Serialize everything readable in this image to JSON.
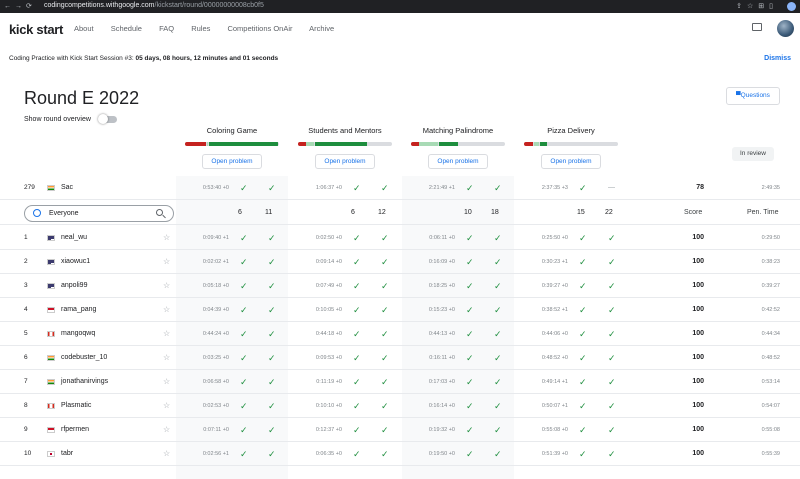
{
  "browser": {
    "host": "codingcompetitions.withgoogle.com",
    "path": "/kickstart/round/00000000008cb0f5"
  },
  "header": {
    "logo": "kick start",
    "nav": [
      "About",
      "Schedule",
      "FAQ",
      "Rules",
      "Competitions OnAir",
      "Archive"
    ]
  },
  "banner": {
    "text": "Coding Practice with Kick Start Session #3:",
    "countdown": "05 days, 08 hours, 12 minutes and 01 seconds",
    "dismiss": "Dismiss"
  },
  "round": {
    "title": "Round E 2022",
    "questions_label": "Questions",
    "overview_label": "Show round overview",
    "review_label": "In review",
    "open_label": "Open problem"
  },
  "problems": [
    {
      "name": "Coloring Game",
      "red": 0.22,
      "light": 0.02,
      "green": 0.73
    },
    {
      "name": "Students and Mentors",
      "red": 0.08,
      "light": 0.08,
      "green": 0.55
    },
    {
      "name": "Matching Palindrome",
      "red": 0.08,
      "light": 0.2,
      "green": 0.2
    },
    {
      "name": "Pizza Delivery",
      "red": 0.1,
      "light": 0.05,
      "green": 0.07
    }
  ],
  "my_row": {
    "rank": "279",
    "flag": "IN",
    "name": "Sac",
    "times": [
      "0:53:40 +0",
      "1:06:37 +0",
      "2:21:49 +1",
      "2:37:35 +3"
    ],
    "p4_second": "—",
    "score": "78",
    "penalty": "2:49:35"
  },
  "header_row": {
    "search": "Everyone",
    "counts": [
      [
        "6",
        "11"
      ],
      [
        "6",
        "12"
      ],
      [
        "10",
        "18"
      ],
      [
        "15",
        "22"
      ]
    ],
    "score_label": "Score",
    "penalty_label": "Pen. Time"
  },
  "rows": [
    {
      "rank": "1",
      "flag": "US",
      "name": "neal_wu",
      "times": [
        "0:09:40 +1",
        "0:02:50 +0",
        "0:06:11 +0",
        "0:25:50 +0"
      ],
      "score": "100",
      "penalty": "0:29:50"
    },
    {
      "rank": "2",
      "flag": "US",
      "name": "xiaowuc1",
      "times": [
        "0:02:02 +1",
        "0:09:14 +0",
        "0:16:09 +0",
        "0:30:23 +1"
      ],
      "score": "100",
      "penalty": "0:38:23"
    },
    {
      "rank": "3",
      "flag": "US",
      "name": "anpoli99",
      "times": [
        "0:05:18 +0",
        "0:07:49 +0",
        "0:18:25 +0",
        "0:39:27 +0"
      ],
      "score": "100",
      "penalty": "0:39:27"
    },
    {
      "rank": "4",
      "flag": "ID",
      "name": "rama_pang",
      "times": [
        "0:04:39 +0",
        "0:10:05 +0",
        "0:15:23 +0",
        "0:38:52 +1"
      ],
      "score": "100",
      "penalty": "0:42:52"
    },
    {
      "rank": "5",
      "flag": "CA",
      "name": "mangoqwq",
      "times": [
        "0:44:24 +0",
        "0:44:18 +0",
        "0:44:13 +0",
        "0:44:06 +0"
      ],
      "score": "100",
      "penalty": "0:44:34"
    },
    {
      "rank": "6",
      "flag": "IN",
      "name": "codebuster_10",
      "times": [
        "0:03:25 +0",
        "0:09:53 +0",
        "0:16:11 +0",
        "0:48:52 +0"
      ],
      "score": "100",
      "penalty": "0:48:52"
    },
    {
      "rank": "7",
      "flag": "IN",
      "name": "jonathanirvings",
      "times": [
        "0:06:58 +0",
        "0:11:19 +0",
        "0:17:03 +0",
        "0:49:14 +1"
      ],
      "score": "100",
      "penalty": "0:53:14"
    },
    {
      "rank": "8",
      "flag": "CA",
      "name": "Plasmatic",
      "times": [
        "0:02:53 +0",
        "0:10:10 +0",
        "0:16:14 +0",
        "0:50:07 +1"
      ],
      "score": "100",
      "penalty": "0:54:07"
    },
    {
      "rank": "9",
      "flag": "ID",
      "name": "rfpermen",
      "times": [
        "0:07:11 +0",
        "0:12:37 +0",
        "0:19:32 +0",
        "0:55:08 +0"
      ],
      "score": "100",
      "penalty": "0:55:08"
    },
    {
      "rank": "10",
      "flag": "JP",
      "name": "tabr",
      "times": [
        "0:02:56 +1",
        "0:06:35 +0",
        "0:19:50 +0",
        "0:51:39 +0"
      ],
      "score": "100",
      "penalty": "0:55:39"
    }
  ],
  "colors": {
    "green": "#1e8e3e",
    "red": "#c5221f",
    "light_green": "#a8dab5",
    "accent": "#1a73e8"
  }
}
